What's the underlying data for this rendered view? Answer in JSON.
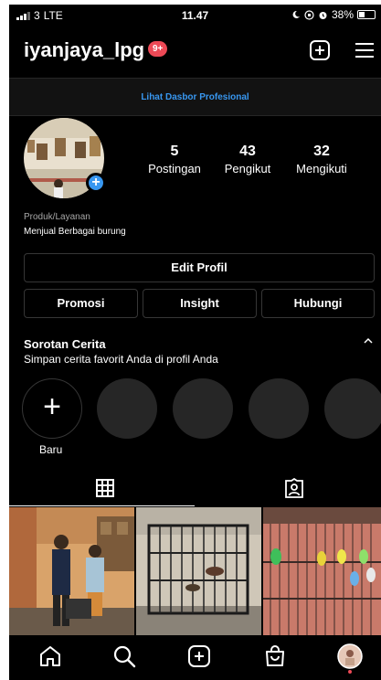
{
  "status_bar": {
    "carrier": "3",
    "network": "LTE",
    "time": "11.47",
    "battery": "38%",
    "battery_level": 0.38
  },
  "header": {
    "username": "iyanjaya_lpg",
    "notifications_badge": "9+"
  },
  "dashboard": {
    "label": "Lihat Dasbor Profesional"
  },
  "profile": {
    "stats": [
      {
        "value": "5",
        "label": "Postingan"
      },
      {
        "value": "43",
        "label": "Pengikut"
      },
      {
        "value": "32",
        "label": "Mengikuti"
      }
    ],
    "category": "Produk/Layanan",
    "bio": "Menjual Berbagai burung"
  },
  "buttons": {
    "edit_profile": "Edit Profil",
    "promote": "Promosi",
    "insight": "Insight",
    "contact": "Hubungi"
  },
  "highlights": {
    "title": "Sorotan Cerita",
    "subtitle": "Simpan cerita favorit Anda di profil Anda",
    "new_label": "Baru"
  },
  "icons": {
    "header": [
      "new-post-icon",
      "menu-icon"
    ],
    "tabs": [
      "grid-icon",
      "tagged-icon"
    ],
    "bottom_nav": [
      "home-icon",
      "search-icon",
      "create-icon",
      "shop-icon",
      "profile-avatar"
    ]
  },
  "colors": {
    "background": "#000000",
    "accent": "#3897f0",
    "badge": "#ed4956",
    "border": "#363636"
  }
}
